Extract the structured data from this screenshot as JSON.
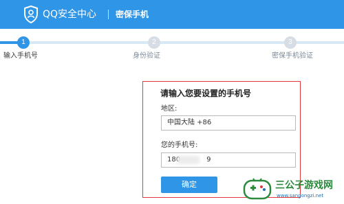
{
  "header": {
    "brand": "QQ安全中心",
    "section": "密保手机",
    "logo_icon": "shield-icon",
    "bar_color": "#2f95e6"
  },
  "steps": [
    {
      "number": "1",
      "label": "输入手机号",
      "state": "active"
    },
    {
      "number": "2",
      "label": "身份验证",
      "state": "pending"
    },
    {
      "number": "3",
      "label": "密保手机验证",
      "state": "pending"
    }
  ],
  "form": {
    "title": "请输入您要设置的手机号",
    "region_label": "地区:",
    "region_value": "中国大陆 +86",
    "phone_label": "您的手机号:",
    "phone_prefix": "180",
    "phone_suffix": "9",
    "confirm_label": "确定",
    "highlight_color": "#e0383e"
  },
  "watermark": {
    "name": "三公子游戏网",
    "url": "www.sangongzi.net"
  }
}
